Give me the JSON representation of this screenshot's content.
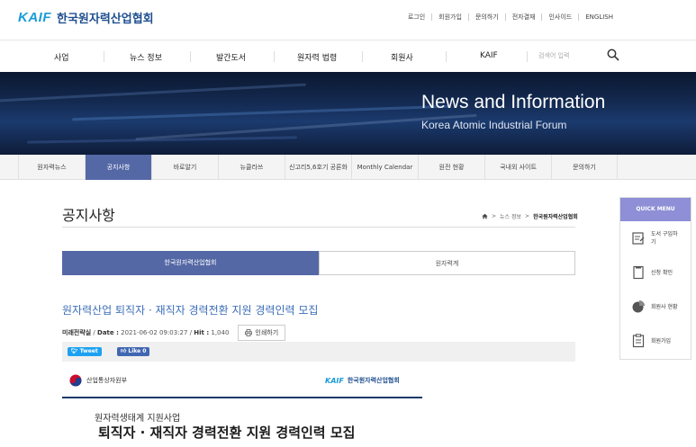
{
  "header": {
    "logo_kaif": "KAIF",
    "logo_org": "한국원자력산업협회",
    "util_links": [
      "로그인",
      "회원가입",
      "문의하기",
      "전자결재",
      "인사이드",
      "ENGLISH"
    ]
  },
  "main_nav": {
    "items": [
      "사업",
      "뉴스 정보",
      "발간도서",
      "원자력 법령",
      "회원사",
      "KAIF"
    ],
    "search_placeholder": "검색어 입력"
  },
  "banner": {
    "title": "News and Information",
    "subtitle": "Korea Atomic Industrial Forum"
  },
  "sub_nav": {
    "tabs": [
      "원자력뉴스",
      "공지사항",
      "바로알기",
      "뉴클라쓰",
      "신고리5,6호기 공론화",
      "Monthly Calendar",
      "원전 현황",
      "국내외 사이트",
      "문의하기"
    ],
    "active_index": 1
  },
  "page": {
    "title": "공지사항",
    "breadcrumb": [
      "뉴스 정보",
      "한국원자력산업협회"
    ]
  },
  "content_tabs": [
    "한국원자력산업협회",
    "원자력계"
  ],
  "article": {
    "title": "원자력산업 퇴직자 · 재직자 경력전환 지원 경력인력 모집",
    "author": "미래전략실",
    "date_label": "Date :",
    "date_value": "2021-06-02 09:03:27",
    "hit_label": "Hit :",
    "hit_value": "1,040",
    "print_label": "인쇄하기",
    "tweet_label": "Tweet",
    "like_label": "Like 0"
  },
  "poster": {
    "ministry": "산업통상자원부",
    "kaif": "KAIF",
    "org": "한국원자력산업협회",
    "subtitle": "원자력생태계 지원사업",
    "headline": "퇴직자 · 재직자 경력전환 지원 경력인력 모집"
  },
  "quick_menu": {
    "title": "QUICK MENU",
    "items": [
      {
        "label": "도서 구입하기",
        "icon": "book-order-icon"
      },
      {
        "label": "신청 확인",
        "icon": "application-check-icon"
      },
      {
        "label": "회원사 현황",
        "icon": "pie-chart-icon"
      },
      {
        "label": "회원가입",
        "icon": "signup-form-icon"
      }
    ]
  },
  "colors": {
    "brand_blue": "#1a9bd7",
    "brand_navy": "#1e4f8f",
    "active_tab": "#5568a6",
    "quick_header": "#8e8fd6",
    "link_blue": "#3b6db8"
  }
}
